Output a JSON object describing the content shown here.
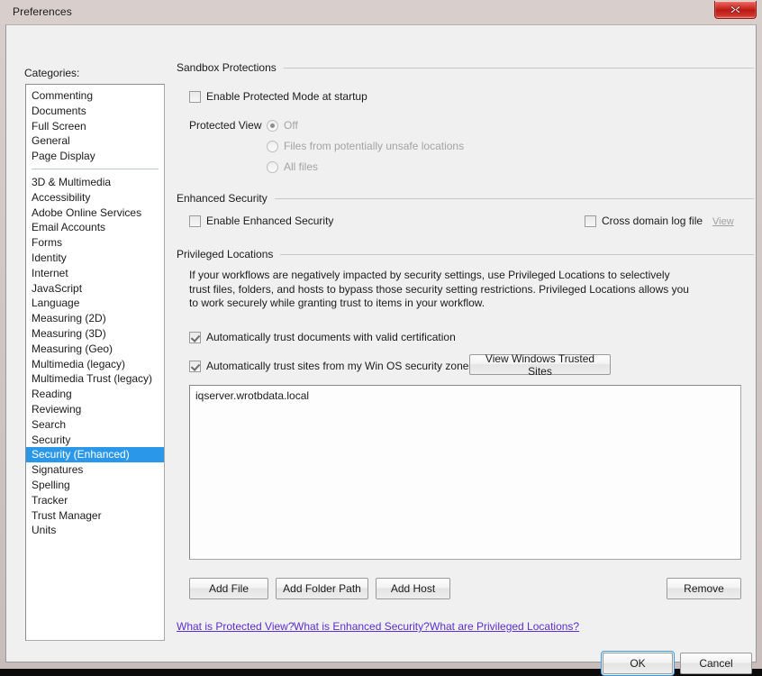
{
  "window": {
    "title": "Preferences",
    "close_icon": "close-icon",
    "accent_selected": "#2a97e8",
    "link_color": "#5b2ed1"
  },
  "sidebar": {
    "label": "Categories:",
    "group1": [
      {
        "label": "Commenting",
        "selected": false
      },
      {
        "label": "Documents",
        "selected": false
      },
      {
        "label": "Full Screen",
        "selected": false
      },
      {
        "label": "General",
        "selected": false
      },
      {
        "label": "Page Display",
        "selected": false
      }
    ],
    "group2": [
      {
        "label": "3D & Multimedia",
        "selected": false
      },
      {
        "label": "Accessibility",
        "selected": false
      },
      {
        "label": "Adobe Online Services",
        "selected": false
      },
      {
        "label": "Email Accounts",
        "selected": false
      },
      {
        "label": "Forms",
        "selected": false
      },
      {
        "label": "Identity",
        "selected": false
      },
      {
        "label": "Internet",
        "selected": false
      },
      {
        "label": "JavaScript",
        "selected": false
      },
      {
        "label": "Language",
        "selected": false
      },
      {
        "label": "Measuring (2D)",
        "selected": false
      },
      {
        "label": "Measuring (3D)",
        "selected": false
      },
      {
        "label": "Measuring (Geo)",
        "selected": false
      },
      {
        "label": "Multimedia (legacy)",
        "selected": false
      },
      {
        "label": "Multimedia Trust (legacy)",
        "selected": false
      },
      {
        "label": "Reading",
        "selected": false
      },
      {
        "label": "Reviewing",
        "selected": false
      },
      {
        "label": "Search",
        "selected": false
      },
      {
        "label": "Security",
        "selected": false
      },
      {
        "label": "Security (Enhanced)",
        "selected": true
      },
      {
        "label": "Signatures",
        "selected": false
      },
      {
        "label": "Spelling",
        "selected": false
      },
      {
        "label": "Tracker",
        "selected": false
      },
      {
        "label": "Trust Manager",
        "selected": false
      },
      {
        "label": "Units",
        "selected": false
      }
    ]
  },
  "sandbox": {
    "title": "Sandbox Protections",
    "enable_protected_mode": {
      "label": "Enable Protected Mode at startup",
      "checked": false
    },
    "protected_view_label": "Protected View",
    "protected_view_options": [
      {
        "label": "Off",
        "selected": true,
        "disabled": true
      },
      {
        "label": "Files from potentially unsafe locations",
        "selected": false,
        "disabled": true
      },
      {
        "label": "All files",
        "selected": false,
        "disabled": true
      }
    ]
  },
  "enhanced_security": {
    "title": "Enhanced Security",
    "enable": {
      "label": "Enable Enhanced Security",
      "checked": false
    },
    "cross_domain_log": {
      "label": "Cross domain log file",
      "checked": false
    },
    "view_link": "View"
  },
  "privileged_locations": {
    "title": "Privileged Locations",
    "description": "If your workflows are negatively impacted by security settings, use Privileged Locations to selectively trust files, folders, and hosts to bypass those security setting restrictions. Privileged Locations allows you to work securely while granting trust to items in your workflow.",
    "trust_certified": {
      "label": "Automatically trust documents with valid certification",
      "checked": true
    },
    "trust_win_zones": {
      "label": "Automatically trust sites from my Win OS security zones",
      "checked": true
    },
    "view_windows_trusted_sites_button": "View Windows Trusted Sites",
    "locations": [
      "iqserver.wrotbdata.local"
    ],
    "add_file_button": "Add File",
    "add_folder_path_button": "Add Folder Path",
    "add_host_button": "Add Host",
    "remove_button": "Remove"
  },
  "help_links": [
    "What is Protected View?",
    "What is Enhanced Security?",
    "What are Privileged Locations?"
  ],
  "footer": {
    "ok_button": "OK",
    "cancel_button": "Cancel"
  }
}
